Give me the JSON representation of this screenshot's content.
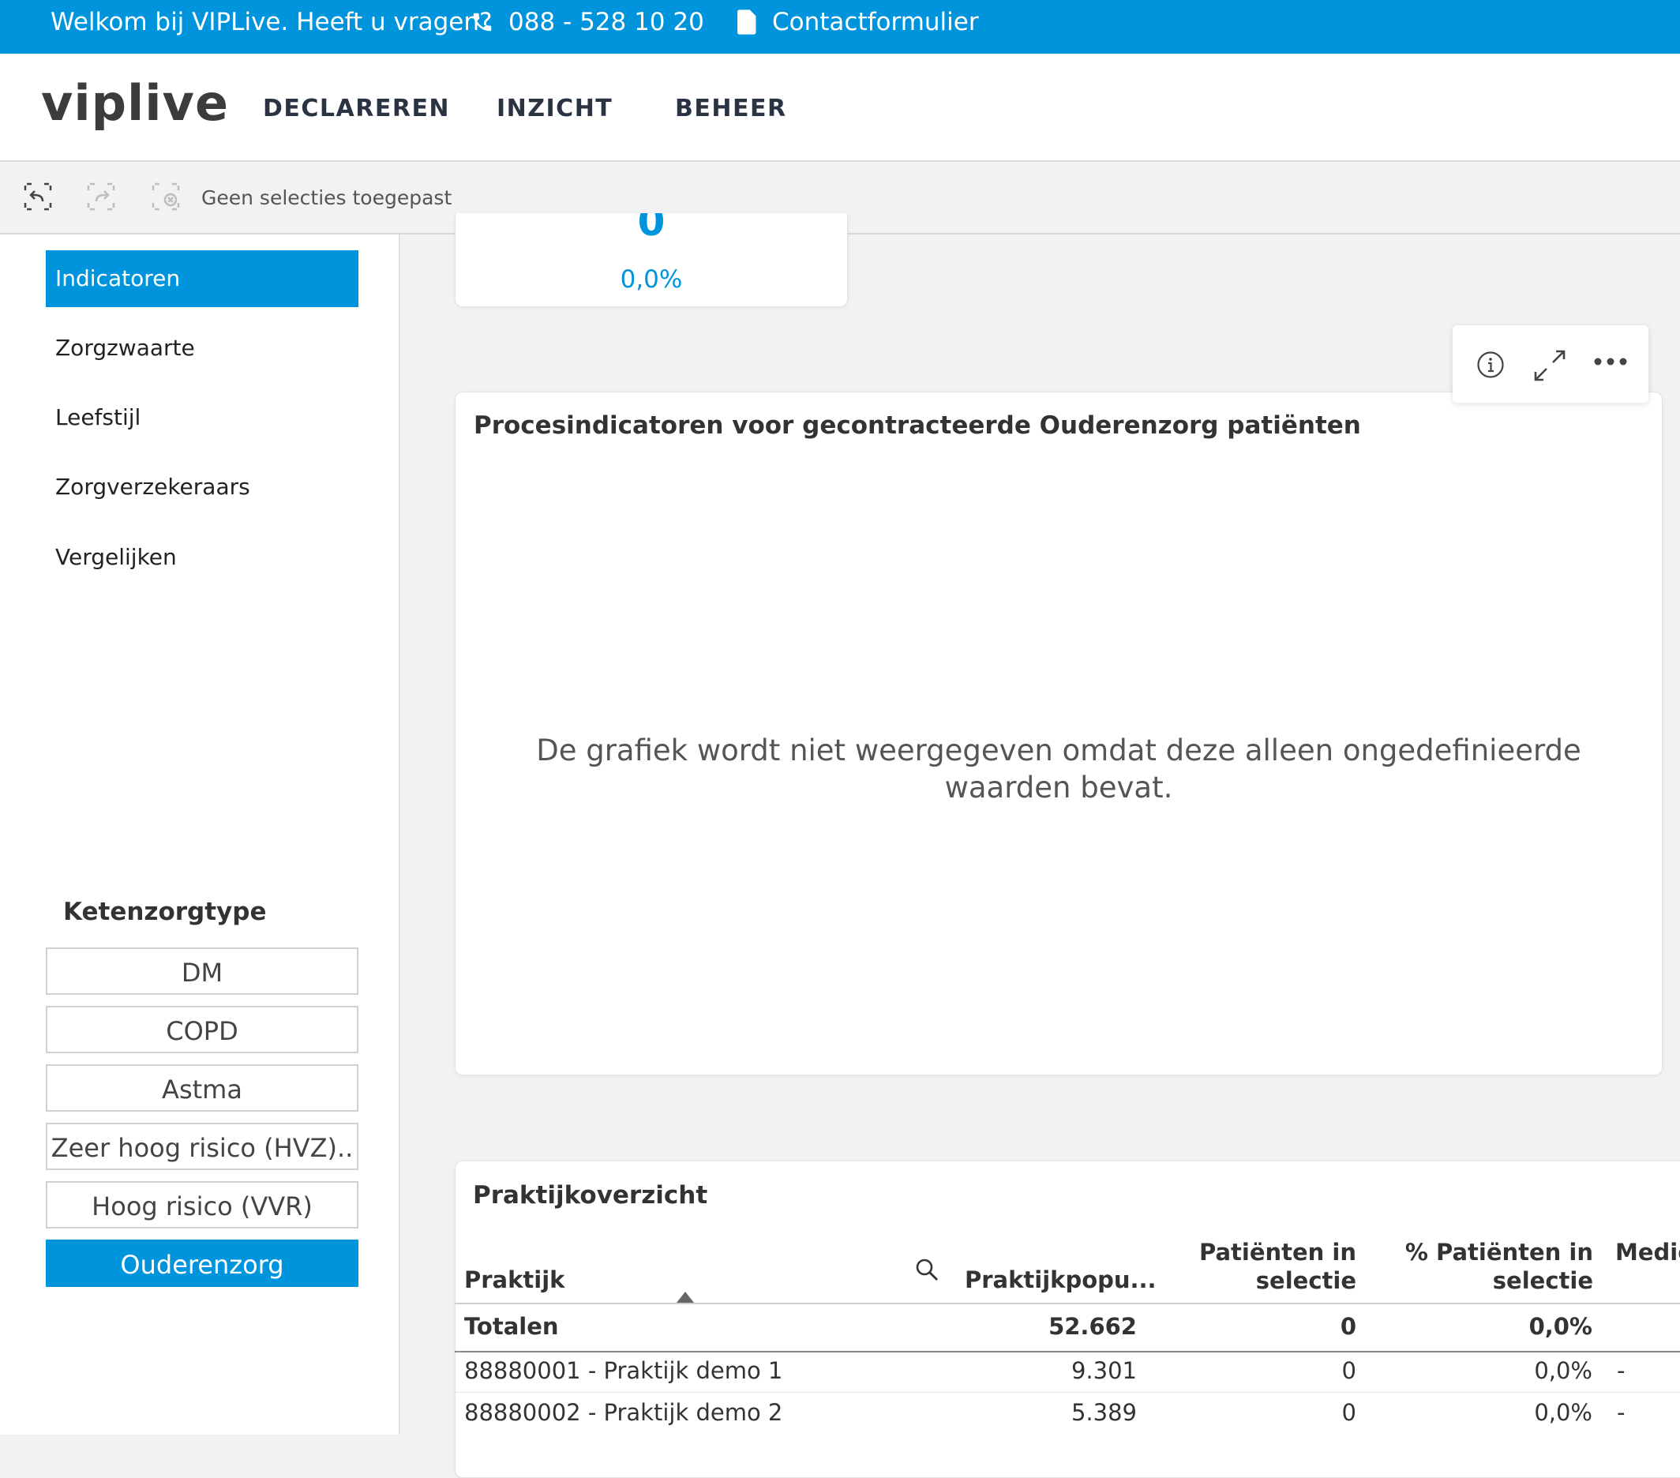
{
  "topbar": {
    "welcome": "Welkom bij VIPLive. Heeft u vragen?",
    "phone": "088 - 528 10 20",
    "contact": "Contactformulier"
  },
  "header": {
    "logo": "viplive",
    "nav": [
      "DECLAREREN",
      "INZICHT",
      "BEHEER"
    ]
  },
  "selections": {
    "text": "Geen selecties toegepast",
    "icons": [
      "step-back-icon",
      "step-forward-icon",
      "clear-selections-icon"
    ]
  },
  "sidebar": {
    "items": [
      {
        "label": "Indicatoren",
        "active": true
      },
      {
        "label": "Zorgzwaarte",
        "active": false
      },
      {
        "label": "Leefstijl",
        "active": false
      },
      {
        "label": "Zorgverzekeraars",
        "active": false
      },
      {
        "label": "Vergelijken",
        "active": false
      }
    ],
    "ketenzorg_title": "Ketenzorgtype",
    "ketenzorg": [
      {
        "label": "DM",
        "active": false
      },
      {
        "label": "COPD",
        "active": false
      },
      {
        "label": "Astma",
        "active": false
      },
      {
        "label": "Zeer hoog risico (HVZ)..",
        "active": false
      },
      {
        "label": "Hoog risico (VVR)",
        "active": false
      },
      {
        "label": "Ouderenzorg",
        "active": true
      }
    ]
  },
  "kpi": {
    "value": "0",
    "percent": "0,0%"
  },
  "toolbar": {
    "icons": [
      "info-icon",
      "expand-icon",
      "more-icon"
    ]
  },
  "chart_card": {
    "title": "Procesindicatoren voor gecontracteerde Ouderenzorg patiënten",
    "message": "De grafiek wordt niet weergegeven omdat deze alleen ongedefinieerde waarden bevat."
  },
  "table": {
    "title": "Praktijkoverzicht",
    "headers": {
      "praktijk": "Praktijk",
      "populatie": "Praktijkpopu...",
      "patienten_1": "Patiënten in",
      "patienten_2": "selectie",
      "pct_1": "% Patiënten in",
      "pct_2": "selectie",
      "medic": "Medic"
    },
    "totals": {
      "label": "Totalen",
      "populatie": "52.662",
      "patienten": "0",
      "pct": "0,0%"
    },
    "rows": [
      {
        "praktijk": "88880001 - Praktijk demo 1",
        "populatie": "9.301",
        "patienten": "0",
        "pct": "0,0%",
        "extra": "-"
      },
      {
        "praktijk": "88880002 - Praktijk demo 2",
        "populatie": "5.389",
        "patienten": "0",
        "pct": "0,0%",
        "extra": "-"
      }
    ]
  },
  "colors": {
    "accent": "#0094dc",
    "header_text": "#2a3342"
  }
}
